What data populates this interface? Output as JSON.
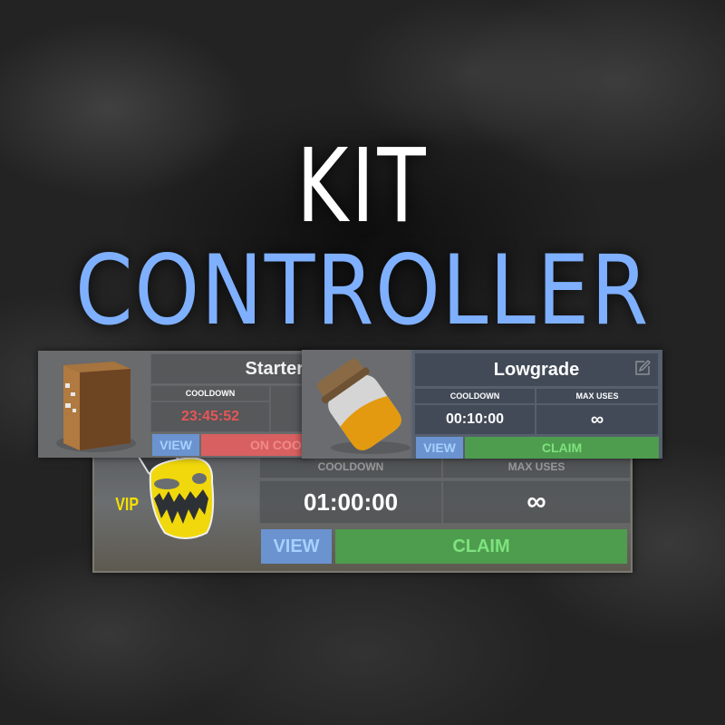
{
  "title": {
    "line1": "KIT",
    "line2": "CONTROLLER",
    "line1_color": "#ffffff",
    "line2_color": "#7fb0ff"
  },
  "cards": [
    {
      "name": "Starter",
      "image": "wooden-locker-icon",
      "cooldown_label": "COOLDOWN",
      "cooldown_value": "23:45:52",
      "cooldown_color": "#e85555",
      "view_label": "VIEW",
      "action_label": "ON COOLDOWN",
      "action_state": "on-cooldown"
    },
    {
      "name": "Lowgrade",
      "image": "lowgrade-fuel-jar-icon",
      "cooldown_label": "COOLDOWN",
      "cooldown_value": "00:10:00",
      "max_uses_label": "MAX USES",
      "max_uses_value": "∞",
      "view_label": "VIEW",
      "action_label": "CLAIM",
      "action_state": "claimable",
      "edit_icon": "edit-icon"
    },
    {
      "name": "VIP",
      "badge": "VIP",
      "image": "yellow-mask-icon",
      "cooldown_label": "COOLDOWN",
      "cooldown_value": "01:00:00",
      "max_uses_label": "MAX USES",
      "max_uses_value": "∞",
      "view_label": "VIEW",
      "action_label": "CLAIM",
      "action_state": "claimable"
    }
  ],
  "colors": {
    "view_bg": "#6a93cf",
    "claim_bg": "#4e9d4e",
    "cooldown_bg": "#d96060"
  }
}
